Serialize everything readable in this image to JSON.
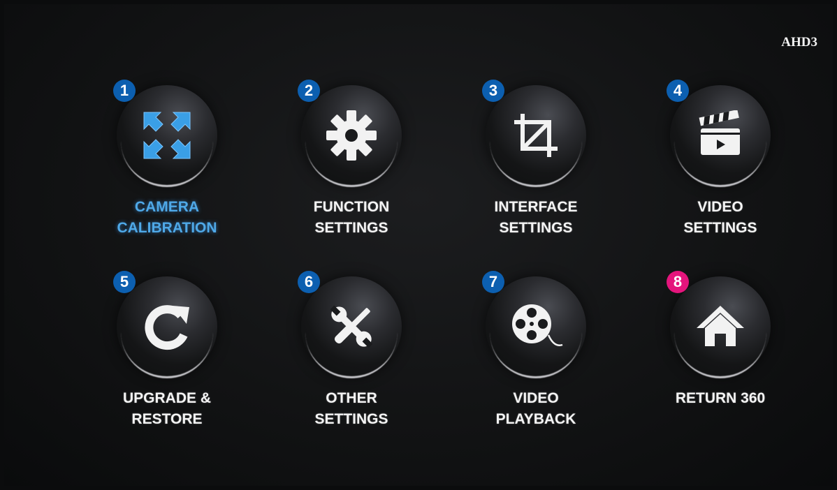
{
  "source_label": "AHD3",
  "menu": [
    {
      "number": "1",
      "line1": "CAMERA",
      "line2": "CALIBRATION",
      "icon": "calibration-arrows-icon",
      "active": true
    },
    {
      "number": "2",
      "line1": "FUNCTION",
      "line2": "SETTINGS",
      "icon": "gear-icon"
    },
    {
      "number": "3",
      "line1": "INTERFACE",
      "line2": "SETTINGS",
      "icon": "crop-icon"
    },
    {
      "number": "4",
      "line1": "VIDEO",
      "line2": "SETTINGS",
      "icon": "clapperboard-icon"
    },
    {
      "number": "5",
      "line1": "UPGRADE &",
      "line2": "RESTORE",
      "icon": "refresh-icon"
    },
    {
      "number": "6",
      "line1": "OTHER",
      "line2": "SETTINGS",
      "icon": "tools-icon"
    },
    {
      "number": "7",
      "line1": "VIDEO",
      "line2": "PLAYBACK",
      "icon": "film-reel-icon"
    },
    {
      "number": "8",
      "line1": "RETURN 360",
      "line2": "",
      "icon": "home-icon"
    }
  ],
  "colors": {
    "badge": "#0c5fb0",
    "badge_highlight": "#e4157c",
    "active_label": "#4fa9e8"
  }
}
